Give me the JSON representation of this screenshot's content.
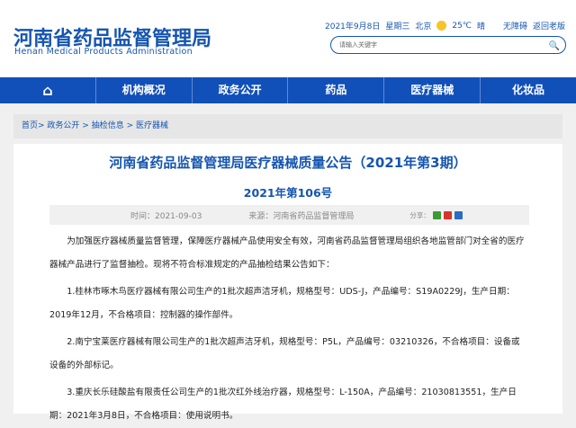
{
  "header": {
    "logo_cn": "河南省药品监督管理局",
    "logo_en": "Henan Medical Products Administration",
    "date": "2021年9月8日",
    "weekday": "星期三",
    "city": "北京",
    "temp": "25℃",
    "weather": "晴",
    "accessibility": "无障碍",
    "old_version": "返回老版",
    "search_placeholder": "请输入关键字"
  },
  "nav": {
    "home_icon": "⌂",
    "items": [
      "机构概况",
      "政务公开",
      "药品",
      "医疗器械",
      "化妆品"
    ]
  },
  "breadcrumb": [
    "首页",
    "政务公开",
    "抽检信息",
    "医疗器械"
  ],
  "article": {
    "title": "河南省药品监督管理局医疗器械质量公告（2021年第3期）",
    "number": "2021年第106号",
    "time": "时间：2021-09-03",
    "source": "来源：河南省药品监督管理局",
    "share": "分享：",
    "paragraphs": [
      "为加强医疗器械质量监督管理，保障医疗器械产品使用安全有效，河南省药品监督管理局组织各地监管部门对全省的医疗器械产品进行了监督抽检。现将不符合标准规定的产品抽检结果公告如下：",
      "1.桂林市啄木鸟医疗器械有限公司生产的1批次超声洁牙机，规格型号：UDS-J，产品编号：S19A0229J，生产日期：2019年12月，不合格项目：控制器的操作部件。",
      "2.南宁宝莱医疗器械有限公司生产的1批次超声洁牙机，规格型号：P5L，产品编号：03210326，不合格项目：设备或设备的外部标记。",
      "3.重庆长乐硅酸盐有限责任公司生产的1批次红外线治疗器，规格型号：L-150A，产品编号：21030813551，生产日期：2021年3月8日，不合格项目：使用说明书。"
    ]
  }
}
